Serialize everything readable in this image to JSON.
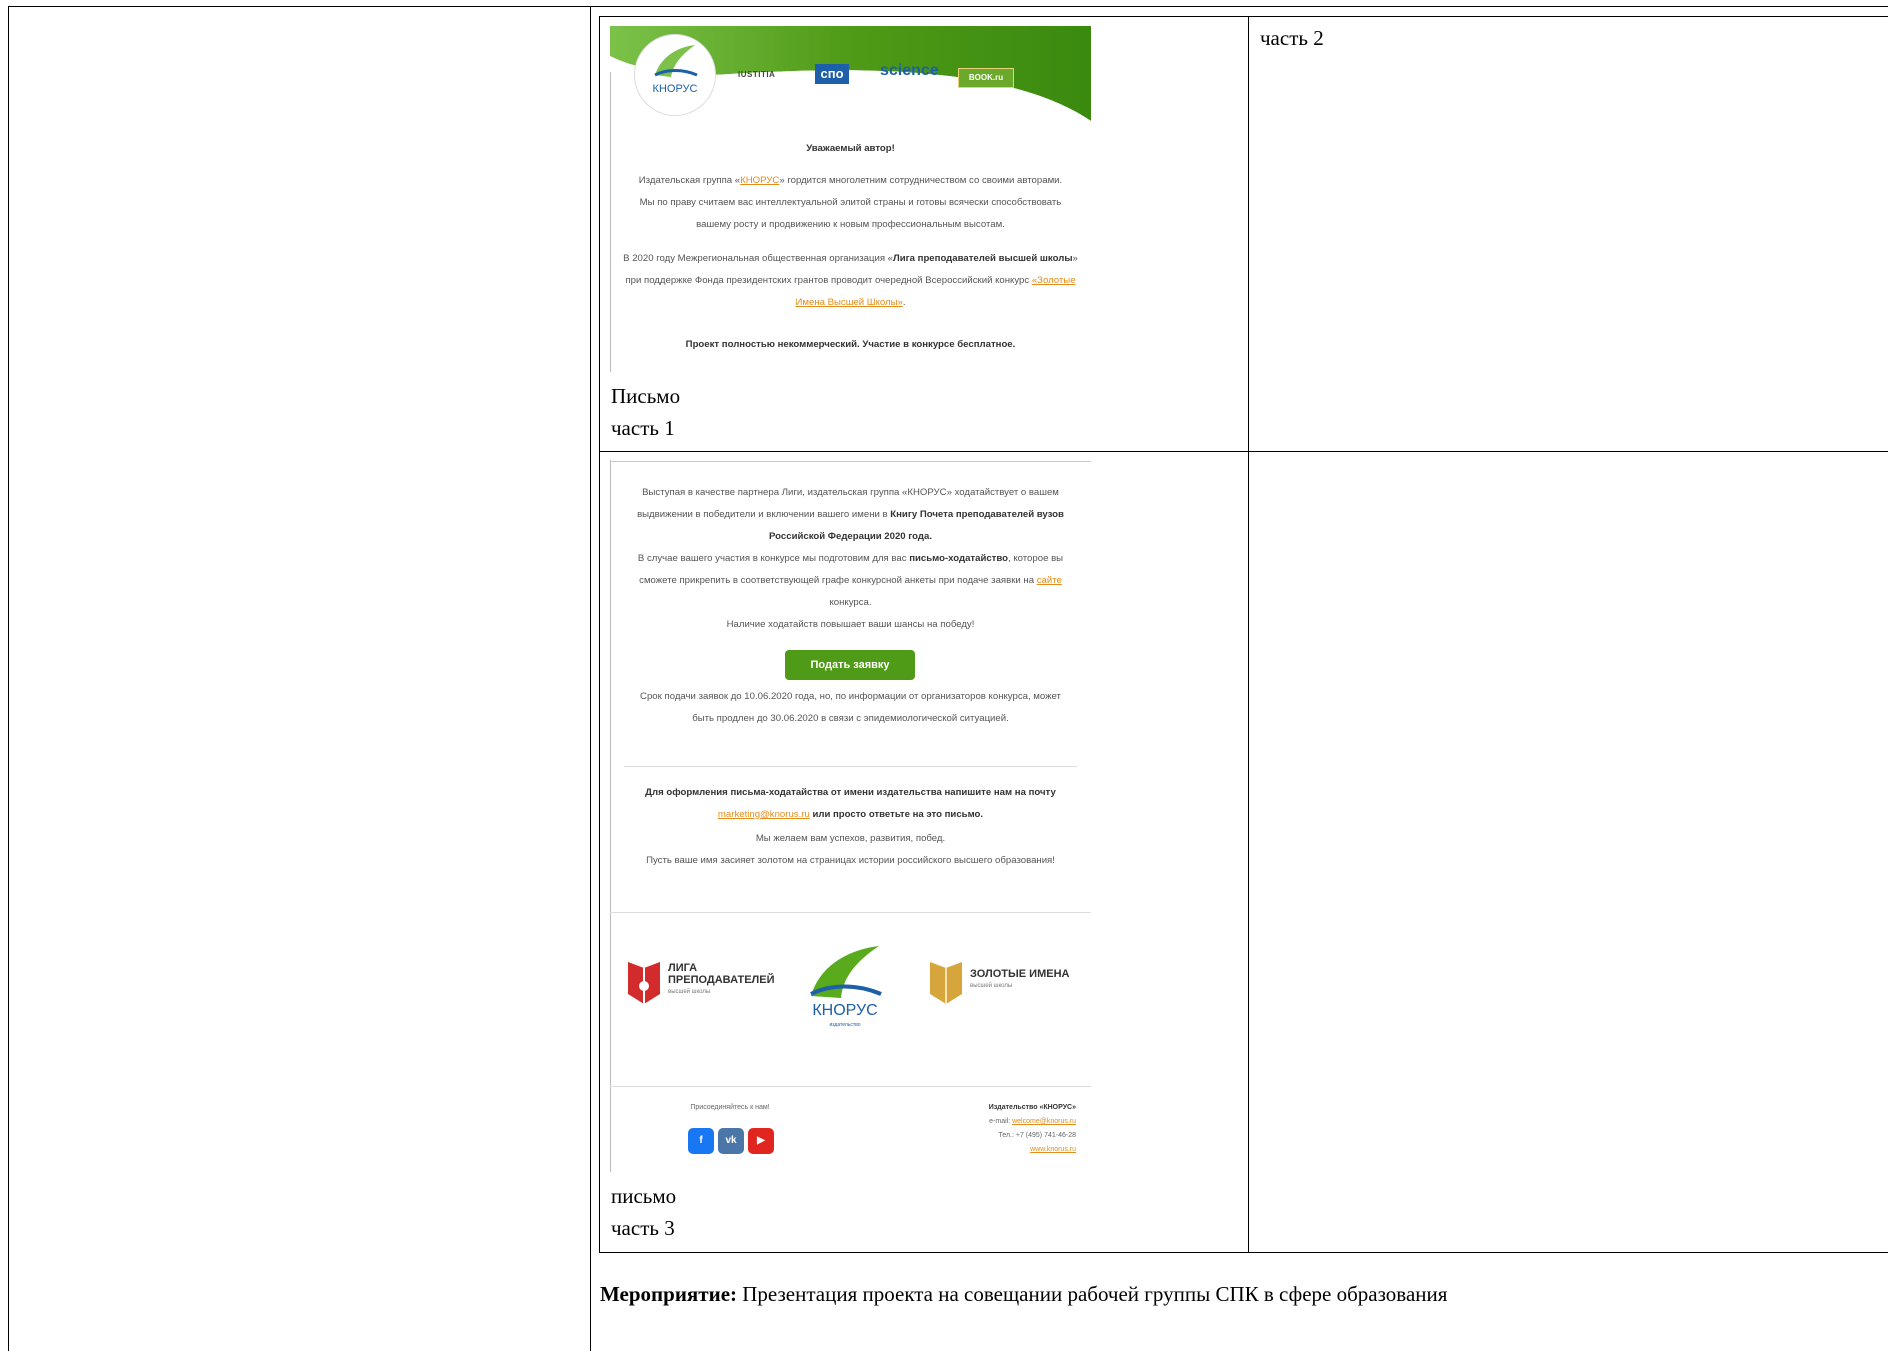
{
  "cells": {
    "top_right_label": "часть 2",
    "part1_caption_line1": "Письмо",
    "part1_caption_line2": "часть 1",
    "part3_caption_line1": "письмо",
    "part3_caption_line2": "часть 3"
  },
  "event": {
    "label": "Мероприятие:",
    "text": " Презентация проекта на совещании рабочей группы СПК в сфере образования"
  },
  "email_part1": {
    "logo_text": "КНОРУС",
    "header_logos": [
      "IUSTITIA",
      "спо",
      "science",
      "BOOK.ru"
    ],
    "greeting": "Уважаемый автор!",
    "p1_a": "Издательская группа «",
    "p1_link": "КНОРУС",
    "p1_b": "» гордится многолетним сотрудничеством со своими авторами. Мы по праву считаем вас интеллектуальной элитой страны и готовы всячески способствовать вашему росту и продвижению к новым профессиональным высотам.",
    "p2_a": "В 2020 году Межрегиональная общественная организация «",
    "p2_bold": "Лига преподавателей высшей школы",
    "p2_b": "» при поддержке Фонда президентских грантов проводит очередной Всероссийский конкурс ",
    "p2_link": "«Золотые Имена Высшей Школы»",
    "p2_c": ".",
    "p3": "Проект полностью некоммерческий. Участие в конкурсе бесплатное."
  },
  "email_part3": {
    "p1_a": "Выступая в качестве партнера Лиги, издательская группа «КНОРУС» ходатайствует о вашем выдвижении в победители и включении вашего имени в ",
    "p1_bold": "Книгу Почета преподавателей вузов Российской Федерации 2020 года.",
    "p2_a": "В случае вашего участия в конкурсе мы подготовим для вас ",
    "p2_bold": "письмо-ходатайство",
    "p2_b": ", которое вы сможете прикрепить в соответствующей графе конкурсной анкеты при подаче заявки на ",
    "p2_link": "сайте",
    "p2_c": " конкурса.",
    "p3": "Наличие ходатайств повышает ваши шансы на победу!",
    "apply_button": "Подать заявку",
    "deadline": "Срок подачи заявок до 10.06.2020 года, но, по информации от организаторов конкурса, может быть продлен до 30.06.2020 в связи с эпидемиологической ситуацией.",
    "contact_bold_a": "Для оформления письма-ходатайства от имени издательства напишите нам на почту ",
    "contact_email": "marketing@knorus.ru",
    "contact_bold_b": " или просто ответьте на это письмо.",
    "wishes1": "Мы желаем вам успехов, развития, побед.",
    "wishes2": "Пусть ваше имя засияет золотом на страницах истории российского высшего образования!",
    "logo_liga_1": "ЛИГА",
    "logo_liga_2": "ПРЕПОДАВАТЕЛЕЙ",
    "logo_liga_3": "высшей школы",
    "logo_knorus": "КНОРУС",
    "logo_knorus_sub": "издательство",
    "logo_gold_1": "ЗОЛОТЫЕ ИМЕНА",
    "logo_gold_2": "высшей школы",
    "footer_join": "Присоединяйтесь к нам!",
    "footer_company": "Издательство «КНОРУС»",
    "footer_email_label": "e-mail: ",
    "footer_email": "welcome@knorus.ru",
    "footer_phone": "Тел.: +7 (495) 741-46-28",
    "footer_site": "www.knorus.ru",
    "social": [
      "f",
      "vk",
      "▶"
    ]
  },
  "colors": {
    "green": "#4f9a16",
    "link_orange": "#e38b1b",
    "knorus_blue": "#1d5fa8"
  }
}
